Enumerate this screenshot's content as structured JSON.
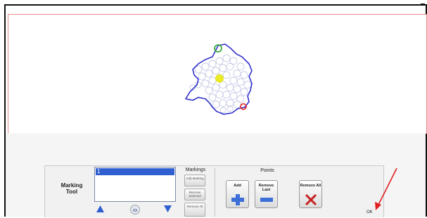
{
  "colors": {
    "canvas_border": "#e48a8a",
    "outline": "#3333cc",
    "start_marker": "#2aa82a",
    "end_marker": "#e02020",
    "center_marker": "#e8e800",
    "selection": "#2f5fd0",
    "arrow_icon": "#2f5fd0",
    "annotation_arrow": "#e02020"
  },
  "marking_tool": {
    "label": "Marking Tool",
    "list_items": [
      "1"
    ],
    "up_icon": "arrow-up-icon",
    "down_icon": "arrow-down-icon",
    "view_icon": "eye-icon"
  },
  "markings": {
    "title": "Markings",
    "add_label": "Add Marking",
    "remove_selected_label": "Remove Selected",
    "remove_all_label": "Remove All"
  },
  "points": {
    "title": "Points",
    "add_label": "Add",
    "remove_last_label": "Remove Last",
    "remove_all_label": "Remove All",
    "add_icon": "plus-icon",
    "remove_last_icon": "minus-icon",
    "remove_all_icon": "x-icon"
  },
  "ok_label": "OK"
}
